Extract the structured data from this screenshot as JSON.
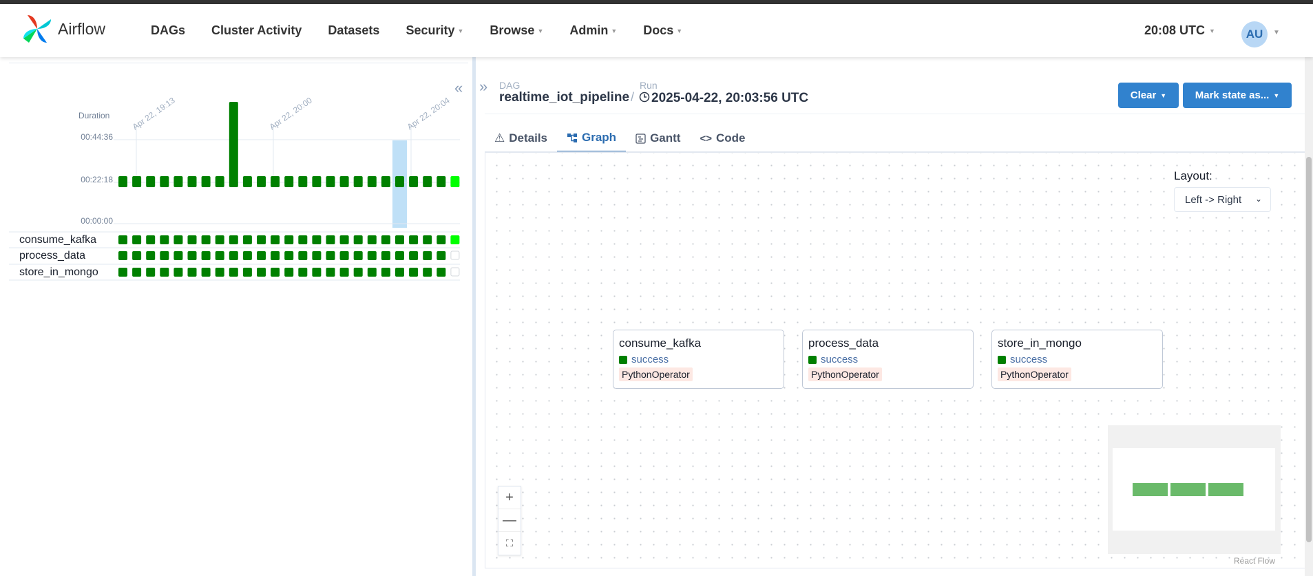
{
  "app": {
    "name": "Airflow"
  },
  "nav": {
    "items": [
      {
        "label": "DAGs",
        "has_caret": false
      },
      {
        "label": "Cluster Activity",
        "has_caret": false
      },
      {
        "label": "Datasets",
        "has_caret": false
      },
      {
        "label": "Security",
        "has_caret": true
      },
      {
        "label": "Browse",
        "has_caret": true
      },
      {
        "label": "Admin",
        "has_caret": true
      },
      {
        "label": "Docs",
        "has_caret": true
      }
    ],
    "clock": "20:08 UTC",
    "user_initials": "AU"
  },
  "grid": {
    "duration_label": "Duration",
    "y_ticks": [
      "00:44:36",
      "00:22:18",
      "00:00:00"
    ],
    "date_labels": [
      "Apr 22, 19:13",
      "Apr 22, 20:00",
      "Apr 22, 20:04"
    ],
    "tasks": [
      "consume_kafka",
      "process_data",
      "store_in_mongo"
    ],
    "runs_count": 25,
    "tall_run_index": 8,
    "selected_run_index": 20,
    "colors": {
      "success": "#008000",
      "running": "#00ff00",
      "selected": "#bfe0f7"
    }
  },
  "breadcrumb": {
    "dag_label": "DAG",
    "dag_id": "realtime_iot_pipeline",
    "separator": "/",
    "run_label": "Run",
    "run_id": "2025-04-22, 20:03:56 UTC"
  },
  "actions": {
    "clear": "Clear",
    "mark_state": "Mark state as..."
  },
  "tabs": [
    {
      "label": "Details",
      "icon": "warning-icon",
      "active": false
    },
    {
      "label": "Graph",
      "icon": "graph-icon",
      "active": true
    },
    {
      "label": "Gantt",
      "icon": "gantt-icon",
      "active": false
    },
    {
      "label": "Code",
      "icon": "code-icon",
      "active": false
    }
  ],
  "graph": {
    "layout_label": "Layout:",
    "layout_value": "Left -> Right",
    "nodes": [
      {
        "id": "consume_kafka",
        "state": "success",
        "operator": "PythonOperator"
      },
      {
        "id": "process_data",
        "state": "success",
        "operator": "PythonOperator"
      },
      {
        "id": "store_in_mongo",
        "state": "success",
        "operator": "PythonOperator"
      }
    ],
    "zoom": {
      "in": "+",
      "out": "—",
      "fit": "⛶"
    },
    "attribution": "React Flow"
  }
}
